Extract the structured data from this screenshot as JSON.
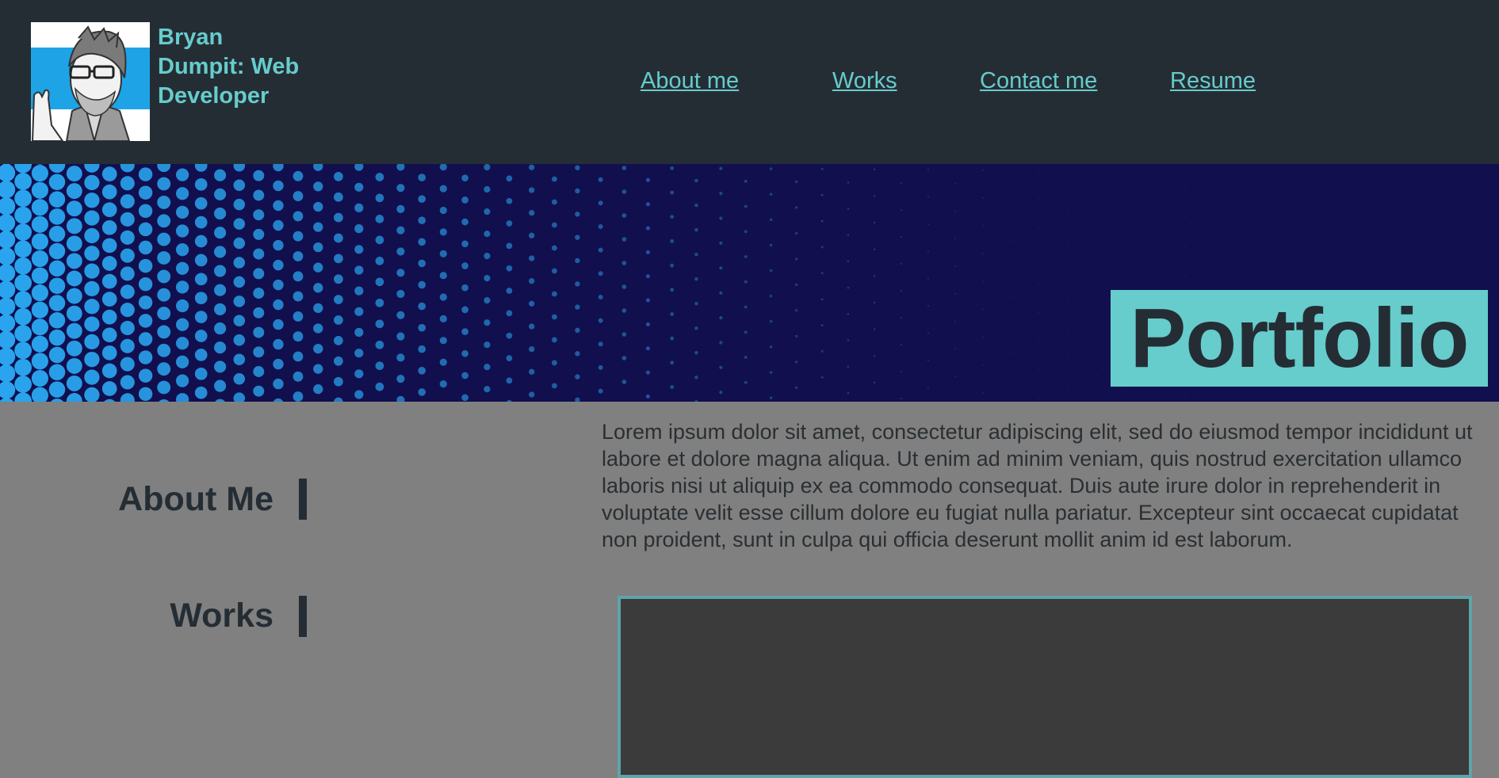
{
  "header": {
    "site_title": "Bryan Dumpit: Web Developer",
    "avatar_icon": "developer-caricature-avatar",
    "nav": [
      {
        "label": "About me"
      },
      {
        "label": "Works"
      },
      {
        "label": "Contact me"
      },
      {
        "label": "Resume"
      }
    ]
  },
  "hero": {
    "title": "Portfolio"
  },
  "sidebar": {
    "items": [
      {
        "label": "About Me"
      },
      {
        "label": "Works"
      }
    ]
  },
  "main": {
    "intro": "Lorem ipsum dolor sit amet, consectetur adipiscing elit, sed do eiusmod tempor incididunt ut labore et dolore magna aliqua. Ut enim ad minim veniam, quis nostrud exercitation ullamco laboris nisi ut aliquip ex ea commodo consequat. Duis aute irure dolor in reprehenderit in voluptate velit esse cillum dolore eu fugiat nulla pariatur. Excepteur sint occaecat cupidatat non proident, sunt in culpa qui officia deserunt mollit anim id est laborum."
  },
  "colors": {
    "header_bg": "#252d34",
    "accent": "#66cccc",
    "page_bg": "#808080",
    "hero_bg": "#120f4e",
    "dot_color": "#2aa6f0",
    "media_bg": "#3b3b3b"
  }
}
